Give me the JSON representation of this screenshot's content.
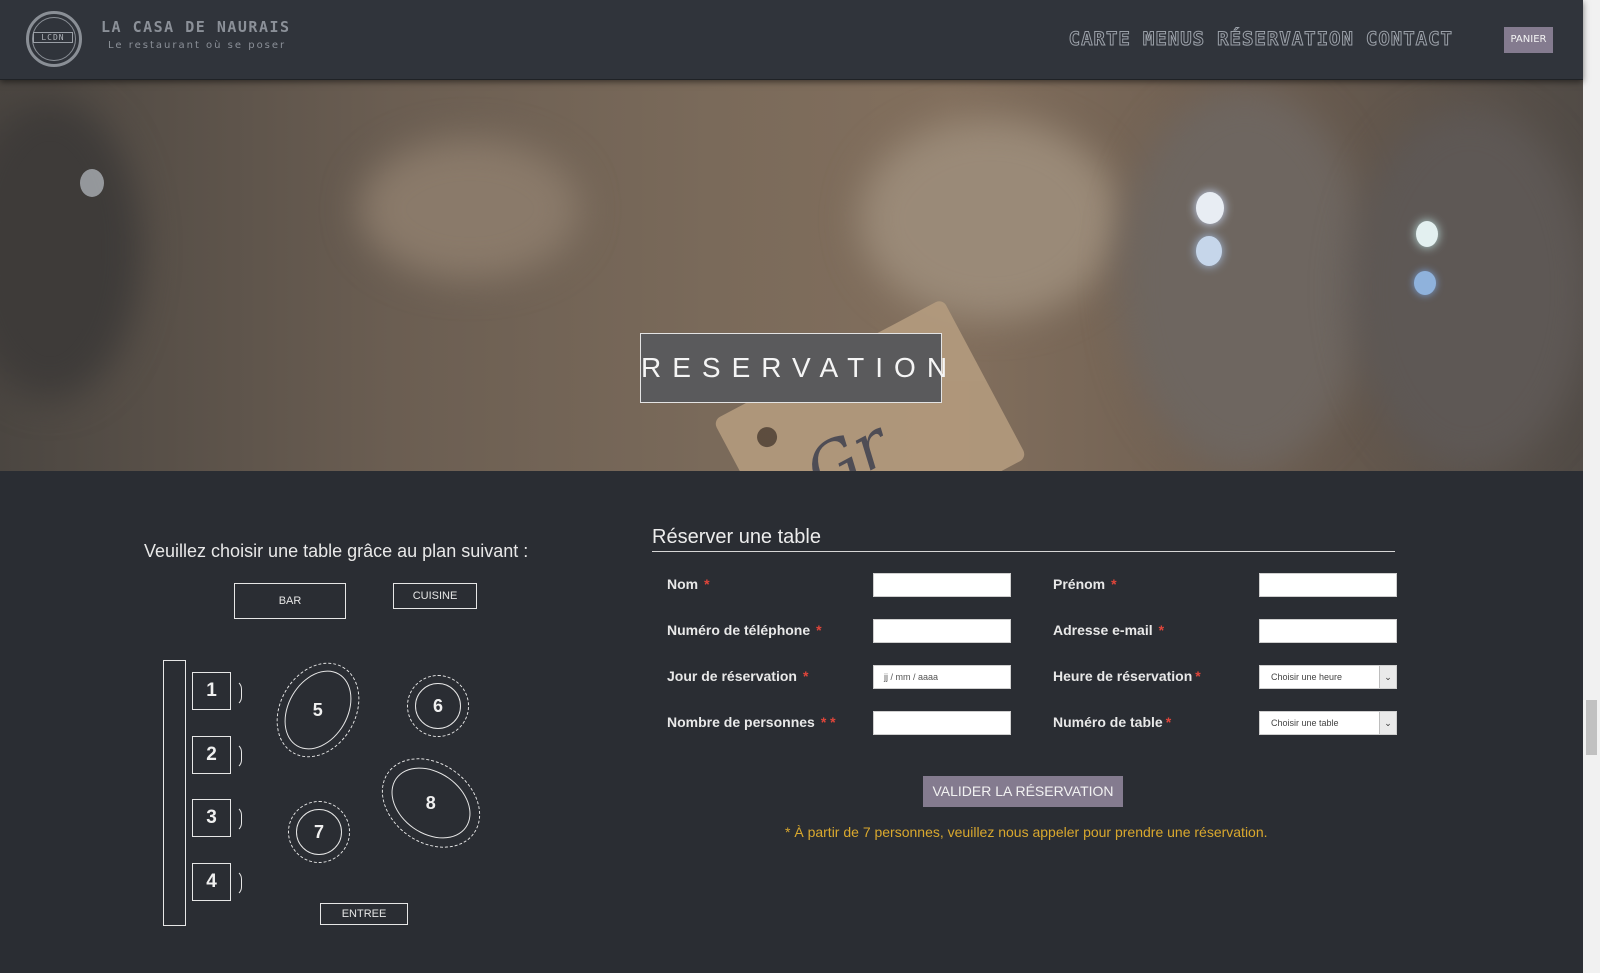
{
  "header": {
    "logo_mono": "LCDN",
    "brand_title": "LA CASA DE NAURAIS",
    "brand_tagline": "Le restaurant où se poser",
    "nav": [
      "CARTE",
      "MENUS",
      "RÉSERVATION",
      "CONTACT"
    ],
    "cart_label": "PANIER"
  },
  "hero": {
    "title": "RESERVATION",
    "tag_text": "Gr"
  },
  "plan": {
    "title": "Veuillez choisir une table grâce au plan suivant :",
    "bar": "BAR",
    "kitchen": "CUISINE",
    "entrance": "ENTREE",
    "tables": [
      "1",
      "2",
      "3",
      "4",
      "5",
      "6",
      "7",
      "8"
    ]
  },
  "form": {
    "title": "Réserver une table",
    "fields": {
      "nom": "Nom",
      "prenom": "Prénom",
      "telephone": "Numéro de téléphone",
      "email": "Adresse e-mail",
      "jour": "Jour de réservation",
      "heure": "Heure de réservation",
      "personnes": "Nombre de personnes",
      "table": "Numéro de table"
    },
    "required_mark": "*",
    "persons_mark": "* *",
    "date_placeholder": "jj / mm / aaaa",
    "heure_selected": "Choisir une heure",
    "table_selected": "Choisir une table",
    "submit": "VALIDER LA RÉSERVATION",
    "note": "* À partir de 7 personnes, veuillez nous appeler pour prendre une réservation."
  },
  "colors": {
    "background": "#2a2d33",
    "header": "#30343b",
    "accent_button": "#847b8f",
    "required": "#e0453a",
    "note": "#d9a82e"
  }
}
